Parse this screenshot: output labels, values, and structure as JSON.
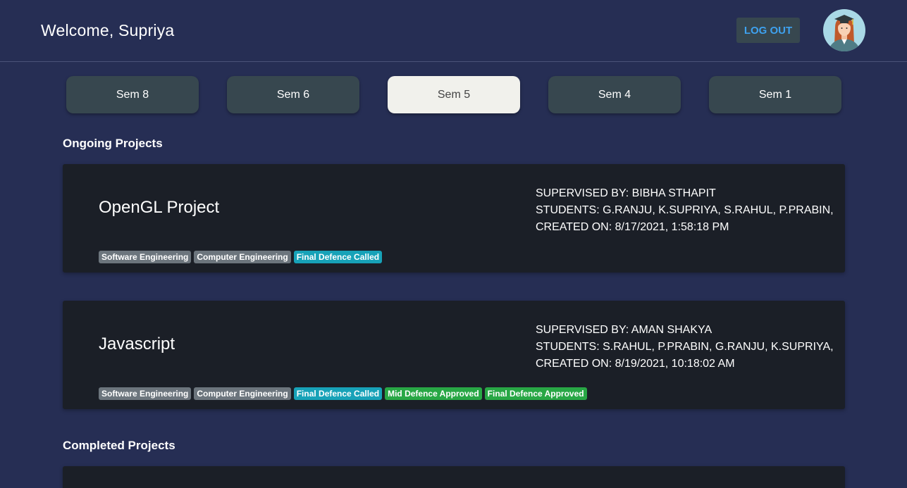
{
  "header": {
    "welcome": "Welcome, Supriya",
    "logout_label": "LOG OUT",
    "avatar_icon": "student-graduate-avatar-icon"
  },
  "semesters": [
    {
      "label": "Sem 8",
      "active": false
    },
    {
      "label": "Sem 6",
      "active": false
    },
    {
      "label": "Sem 5",
      "active": true
    },
    {
      "label": "Sem 4",
      "active": false
    },
    {
      "label": "Sem 1",
      "active": false
    }
  ],
  "ongoing": {
    "title": "Ongoing Projects",
    "projects": [
      {
        "name": "OpenGL Project",
        "supervised": "SUPERVISED BY: BIBHA STHAPIT",
        "students": "STUDENTS: G.RANJU, K.SUPRIYA, S.RAHUL, P.PRABIN,",
        "created": "CREATED ON: 8/17/2021, 1:58:18 PM",
        "badges": [
          {
            "label": "Software Engineering",
            "color": "#6c757d"
          },
          {
            "label": "Computer Engineering",
            "color": "#6c757d"
          },
          {
            "label": "Final Defence Called",
            "color": "#17a2b8"
          }
        ]
      },
      {
        "name": "Javascript",
        "supervised": "SUPERVISED BY: AMAN SHAKYA",
        "students": "STUDENTS: S.RAHUL, P.PRABIN, G.RANJU, K.SUPRIYA,",
        "created": "CREATED ON: 8/19/2021, 10:18:02 AM",
        "badges": [
          {
            "label": "Software Engineering",
            "color": "#6c757d"
          },
          {
            "label": "Computer Engineering",
            "color": "#6c757d"
          },
          {
            "label": "Final Defence Called",
            "color": "#17a2b8"
          },
          {
            "label": "Mid Defence Approved",
            "color": "#28a745"
          },
          {
            "label": "Final Defence Approved",
            "color": "#28a745"
          }
        ]
      }
    ]
  },
  "completed": {
    "title": "Completed Projects"
  }
}
